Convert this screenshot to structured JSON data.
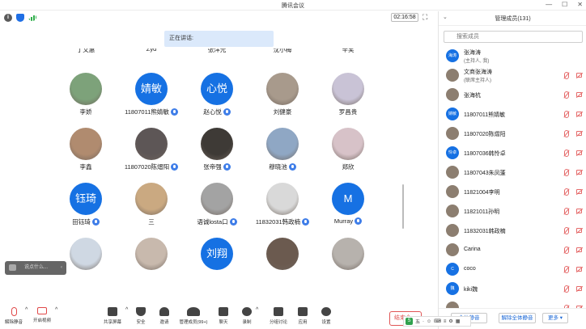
{
  "window": {
    "title": "腾讯会议"
  },
  "status": {
    "timer": "02:16:58"
  },
  "speaking": {
    "label": "正在讲话:"
  },
  "grid": {
    "top_row": [
      "丁文惠",
      "Zyd",
      "张洋元",
      "沈小梅",
      "辛笑"
    ],
    "tiles": [
      {
        "name": "李娇",
        "letter": "",
        "avatar": "photo"
      },
      {
        "name": "11807011熊婧敏",
        "letter": "婧敏",
        "avatar": "letter",
        "mic": true
      },
      {
        "name": "赵心悦",
        "letter": "心悦",
        "avatar": "letter",
        "mic": true
      },
      {
        "name": "刘健豪",
        "letter": "",
        "avatar": "photo"
      },
      {
        "name": "罗昌贵",
        "letter": "",
        "avatar": "photo"
      },
      {
        "name": "李鑫",
        "letter": "",
        "avatar": "photo"
      },
      {
        "name": "11807020陈熠阳",
        "letter": "",
        "avatar": "photo",
        "mic": true
      },
      {
        "name": "张帝强",
        "letter": "",
        "avatar": "photo",
        "mic": true
      },
      {
        "name": "穆晓池",
        "letter": "",
        "avatar": "photo",
        "mic": true
      },
      {
        "name": "郑欣",
        "letter": "",
        "avatar": "photo"
      },
      {
        "name": "田钰琦",
        "letter": "钰琦",
        "avatar": "letter",
        "mic": true
      },
      {
        "name": "三",
        "letter": "",
        "avatar": "photo"
      },
      {
        "name": "语诚losta口",
        "letter": "",
        "avatar": "photo",
        "mic": true
      },
      {
        "name": "11832031韩政楠",
        "letter": "",
        "avatar": "photo",
        "mic": true
      },
      {
        "name": "Murray",
        "letter": "M",
        "avatar": "letter",
        "mic": true
      },
      {
        "name": "",
        "letter": "",
        "avatar": "photo"
      },
      {
        "name": "",
        "letter": "",
        "avatar": "photo"
      },
      {
        "name": "",
        "letter": "刘翔",
        "avatar": "letter"
      },
      {
        "name": "",
        "letter": "",
        "avatar": "photo"
      },
      {
        "name": "",
        "letter": "",
        "avatar": "photo"
      }
    ]
  },
  "chat_pill": {
    "text": "说点什么..."
  },
  "panel": {
    "title": "管理成员(131)",
    "search_placeholder": "搜索成员",
    "members": [
      {
        "name": "张海涛",
        "role": "(主持人, 我)",
        "avatar_text": "海涛",
        "avatar": "letter"
      },
      {
        "name": "文商张海涛",
        "role": "(联席主持人)",
        "avatar_text": "",
        "avatar": "photo"
      },
      {
        "name": "张海杭",
        "role": "",
        "avatar_text": "",
        "avatar": "photo"
      },
      {
        "name": "11807011熊婧敏",
        "role": "",
        "avatar_text": "婧敏",
        "avatar": "letter"
      },
      {
        "name": "11807020陈熠阳",
        "role": "",
        "avatar_text": "",
        "avatar": "photo"
      },
      {
        "name": "11807036韩怜卓",
        "role": "",
        "avatar_text": "怜卓",
        "avatar": "letter"
      },
      {
        "name": "11807043朱凤蓬",
        "role": "",
        "avatar_text": "",
        "avatar": "photo"
      },
      {
        "name": "11821004李明",
        "role": "",
        "avatar_text": "",
        "avatar": "photo"
      },
      {
        "name": "11821011孙明",
        "role": "",
        "avatar_text": "",
        "avatar": "photo"
      },
      {
        "name": "11832031韩政楠",
        "role": "",
        "avatar_text": "",
        "avatar": "photo"
      },
      {
        "name": "Carina",
        "role": "",
        "avatar_text": "",
        "avatar": "photo"
      },
      {
        "name": "coco",
        "role": "",
        "avatar_text": "C",
        "avatar": "letter"
      },
      {
        "name": "kiki魏",
        "role": "",
        "avatar_text": "魏",
        "avatar": "letter"
      },
      {
        "name": "",
        "role": "",
        "avatar_text": "",
        "avatar": "photo"
      }
    ],
    "mute_all": "全体静音",
    "unmute_all": "解除全体静音",
    "more": "更多 ▾"
  },
  "toolbar": {
    "unmute": "解除静音",
    "start_video": "开启视频",
    "share_screen": "共享屏幕",
    "security": "安全",
    "invite": "邀请",
    "manage_members": "管理成员(99+)",
    "chat": "聊天",
    "record": "录制",
    "breakout": "分组讨论",
    "apps": "应用",
    "settings": "设置",
    "end_meeting": "结束会"
  },
  "ime": {
    "items": [
      "五",
      "·",
      "☺",
      "⌨",
      "≡",
      "⚙",
      "▦"
    ]
  },
  "colors": {
    "accent": "#1671e3",
    "danger": "#e05555"
  }
}
